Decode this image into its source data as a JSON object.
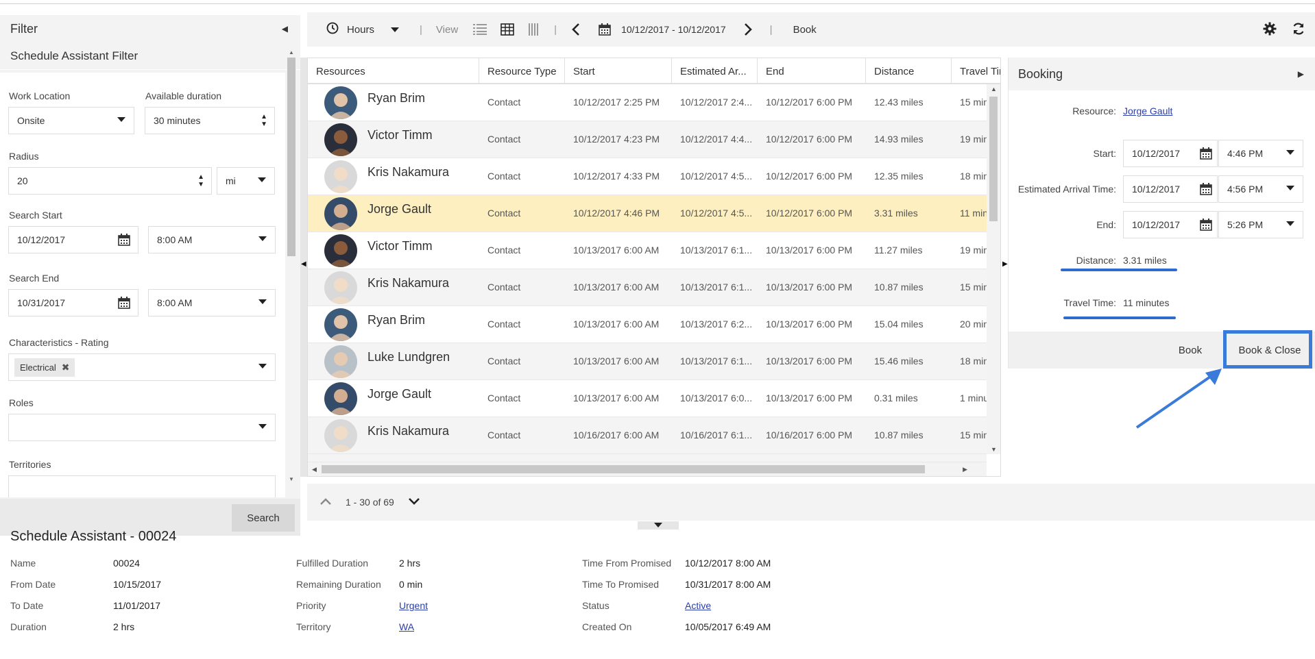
{
  "filter": {
    "title": "Filter",
    "subtitle": "Schedule Assistant Filter",
    "work_location_label": "Work Location",
    "work_location_value": "Onsite",
    "available_duration_label": "Available duration",
    "available_duration_value": "30 minutes",
    "radius_label": "Radius",
    "radius_value": "20",
    "radius_unit": "mi",
    "search_start_label": "Search Start",
    "search_start_date": "10/12/2017",
    "search_start_time": "8:00 AM",
    "search_end_label": "Search End",
    "search_end_date": "10/31/2017",
    "search_end_time": "8:00 AM",
    "characteristics_label": "Characteristics - Rating",
    "characteristics_tag": "Electrical",
    "roles_label": "Roles",
    "territories_label": "Territories",
    "search_button": "Search"
  },
  "toolbar": {
    "hours_label": "Hours",
    "view_label": "View",
    "date_range": "10/12/2017 - 10/12/2017",
    "book_label": "Book",
    "icons": [
      "clock-icon",
      "list-view-icon",
      "grid-view-icon",
      "column-view-icon",
      "prev-icon",
      "calendar-icon",
      "next-icon",
      "gear-icon",
      "refresh-icon"
    ]
  },
  "grid": {
    "columns": [
      "Resources",
      "Resource Type",
      "Start",
      "Estimated Ar...",
      "End",
      "Distance",
      "Travel Tir"
    ],
    "rows": [
      {
        "name": "Ryan Brim",
        "type": "Contact",
        "start": "10/12/2017 2:25 PM",
        "arrival": "10/12/2017 2:4...",
        "end": "10/12/2017 6:00 PM",
        "distance": "12.43 miles",
        "travel": "15 min"
      },
      {
        "name": "Victor Timm",
        "type": "Contact",
        "start": "10/12/2017 4:23 PM",
        "arrival": "10/12/2017 4:4...",
        "end": "10/12/2017 6:00 PM",
        "distance": "14.93 miles",
        "travel": "19 min"
      },
      {
        "name": "Kris Nakamura",
        "type": "Contact",
        "start": "10/12/2017 4:33 PM",
        "arrival": "10/12/2017 4:5...",
        "end": "10/12/2017 6:00 PM",
        "distance": "12.35 miles",
        "travel": "18 min"
      },
      {
        "name": "Jorge Gault",
        "type": "Contact",
        "start": "10/12/2017 4:46 PM",
        "arrival": "10/12/2017 4:5...",
        "end": "10/12/2017 6:00 PM",
        "distance": "3.31 miles",
        "travel": "11 min"
      },
      {
        "name": "Victor Timm",
        "type": "Contact",
        "start": "10/13/2017 6:00 AM",
        "arrival": "10/13/2017 6:1...",
        "end": "10/13/2017 6:00 PM",
        "distance": "11.27 miles",
        "travel": "19 min"
      },
      {
        "name": "Kris Nakamura",
        "type": "Contact",
        "start": "10/13/2017 6:00 AM",
        "arrival": "10/13/2017 6:1...",
        "end": "10/13/2017 6:00 PM",
        "distance": "10.87 miles",
        "travel": "15 min"
      },
      {
        "name": "Ryan Brim",
        "type": "Contact",
        "start": "10/13/2017 6:00 AM",
        "arrival": "10/13/2017 6:2...",
        "end": "10/13/2017 6:00 PM",
        "distance": "15.04 miles",
        "travel": "20 min"
      },
      {
        "name": "Luke Lundgren",
        "type": "Contact",
        "start": "10/13/2017 6:00 AM",
        "arrival": "10/13/2017 6:1...",
        "end": "10/13/2017 6:00 PM",
        "distance": "15.46 miles",
        "travel": "18 min"
      },
      {
        "name": "Jorge Gault",
        "type": "Contact",
        "start": "10/13/2017 6:00 AM",
        "arrival": "10/13/2017 6:0...",
        "end": "10/13/2017 6:00 PM",
        "distance": "0.31 miles",
        "travel": "1 minu"
      },
      {
        "name": "Kris Nakamura",
        "type": "Contact",
        "start": "10/16/2017 6:00 AM",
        "arrival": "10/16/2017 6:1...",
        "end": "10/16/2017 6:00 PM",
        "distance": "10.87 miles",
        "travel": "15 min"
      }
    ]
  },
  "booking": {
    "title": "Booking",
    "resource_label": "Resource:",
    "resource_value": "Jorge Gault",
    "start_label": "Start:",
    "start_date": "10/12/2017",
    "start_time": "4:46 PM",
    "arrival_label": "Estimated Arrival Time:",
    "arrival_date": "10/12/2017",
    "arrival_time": "4:56 PM",
    "end_label": "End:",
    "end_date": "10/12/2017",
    "end_time": "5:26 PM",
    "distance_label": "Distance:",
    "distance_value": "3.31 miles",
    "travel_label": "Travel Time:",
    "travel_value": "11 minutes",
    "book_button": "Book",
    "book_close_button": "Book & Close"
  },
  "pager": {
    "range": "1 - 30 of 69"
  },
  "details": {
    "title": "Schedule Assistant - 00024",
    "col1": [
      {
        "label": "Name",
        "value": "00024"
      },
      {
        "label": "From Date",
        "value": "10/15/2017"
      },
      {
        "label": "To Date",
        "value": "11/01/2017"
      },
      {
        "label": "Duration",
        "value": "2 hrs"
      }
    ],
    "col2": [
      {
        "label": "Fulfilled Duration",
        "value": "2 hrs"
      },
      {
        "label": "Remaining Duration",
        "value": "0 min"
      },
      {
        "label": "Priority",
        "value": "Urgent"
      },
      {
        "label": "Territory",
        "value": "WA"
      }
    ],
    "col3": [
      {
        "label": "Time From Promised",
        "value": "10/12/2017 8:00 AM"
      },
      {
        "label": "Time To Promised",
        "value": "10/31/2017 8:00 AM"
      },
      {
        "label": "Status",
        "value": "Active"
      },
      {
        "label": "Created On",
        "value": "10/05/2017 6:49 AM"
      }
    ]
  },
  "colors": {
    "selected_row": "#fdefc0",
    "annotation_blue": "#2f6ad0",
    "link": "#2a3ea8"
  }
}
